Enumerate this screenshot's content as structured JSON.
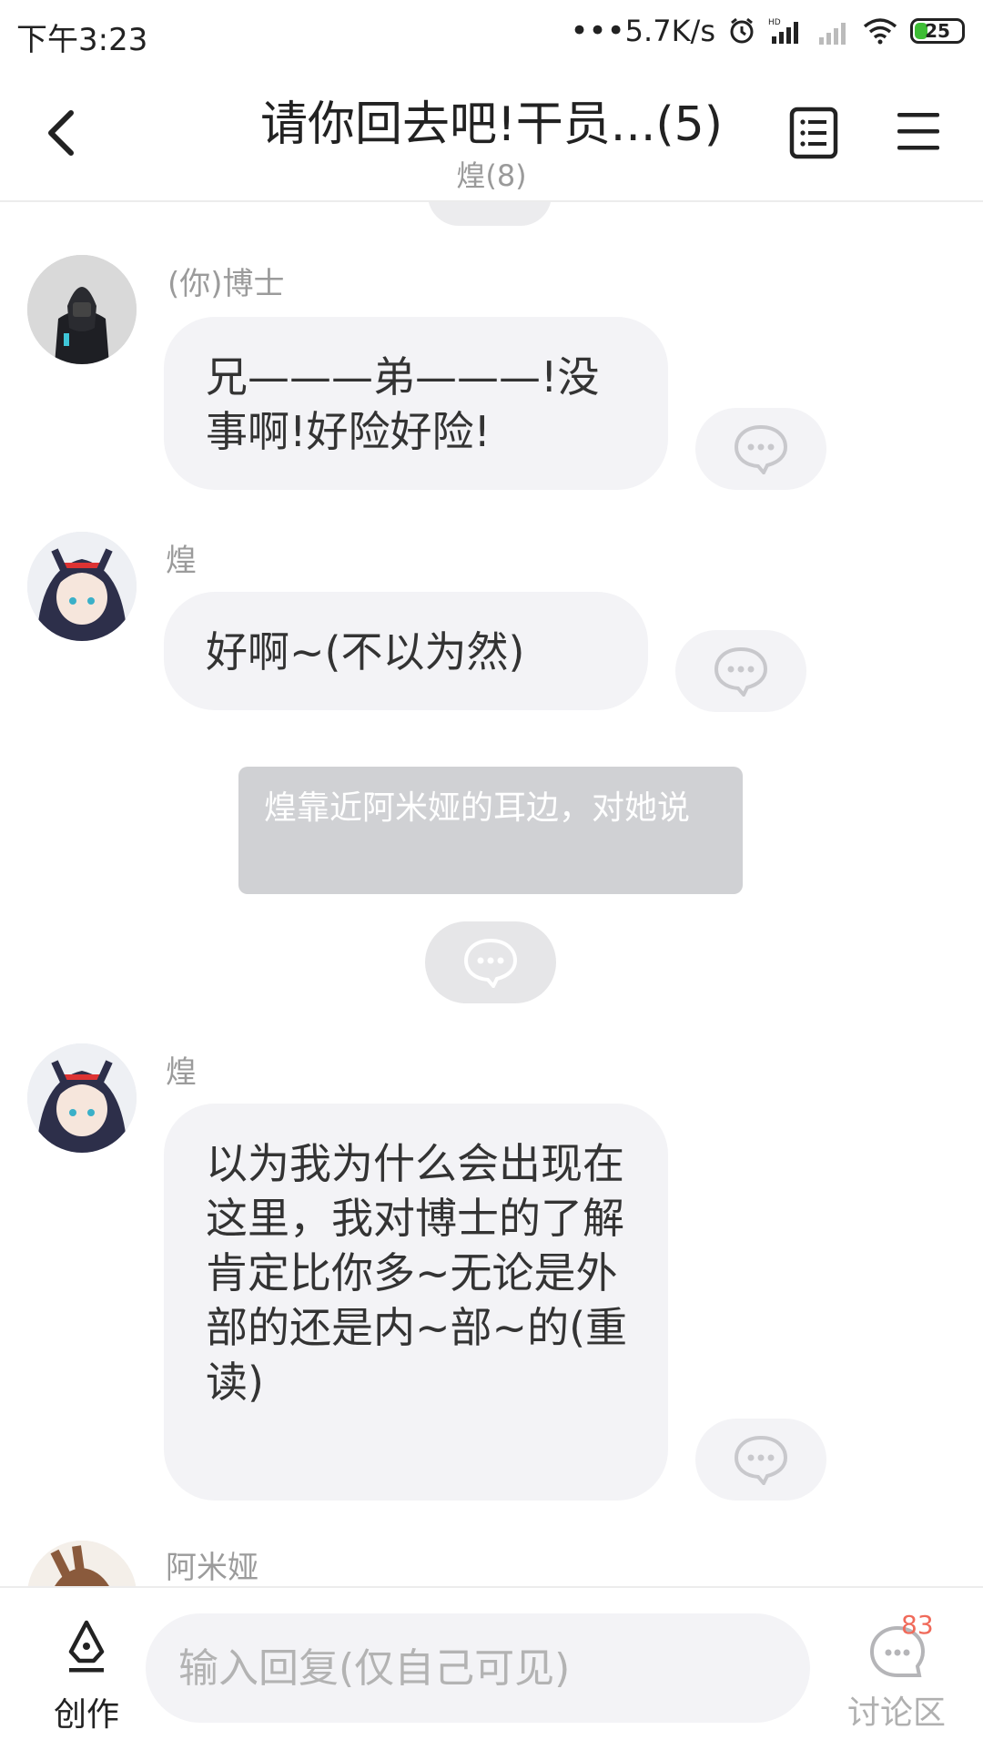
{
  "status_bar": {
    "time": "下午3:23",
    "network_speed": "5.7K/s",
    "battery": "25"
  },
  "header": {
    "title": "请你回去吧!干员...(5)",
    "subtitle": "煌(8)"
  },
  "messages": [
    {
      "sender": "(你)博士",
      "text": "兄———弟———!没事啊!好险好险!"
    },
    {
      "sender": "煌",
      "text": "好啊~(不以为然)"
    },
    {
      "narration": "煌靠近阿米娅的耳边，对她说"
    },
    {
      "sender": "煌",
      "text": "以为我为什么会出现在这里，我对博士的了解肯定比你多~无论是外部的还是内~部~的(重读)"
    },
    {
      "sender": "阿米娅"
    }
  ],
  "bottom": {
    "create_label": "创作",
    "input_placeholder": "输入回复(仅自己可见)",
    "discuss_count": "83",
    "discuss_label": "讨论区"
  },
  "colors": {
    "bubble": "#f3f3f6",
    "narration": "#d0d1d4",
    "badge": "#f06a5a",
    "battery_fill": "#3ebd35"
  }
}
